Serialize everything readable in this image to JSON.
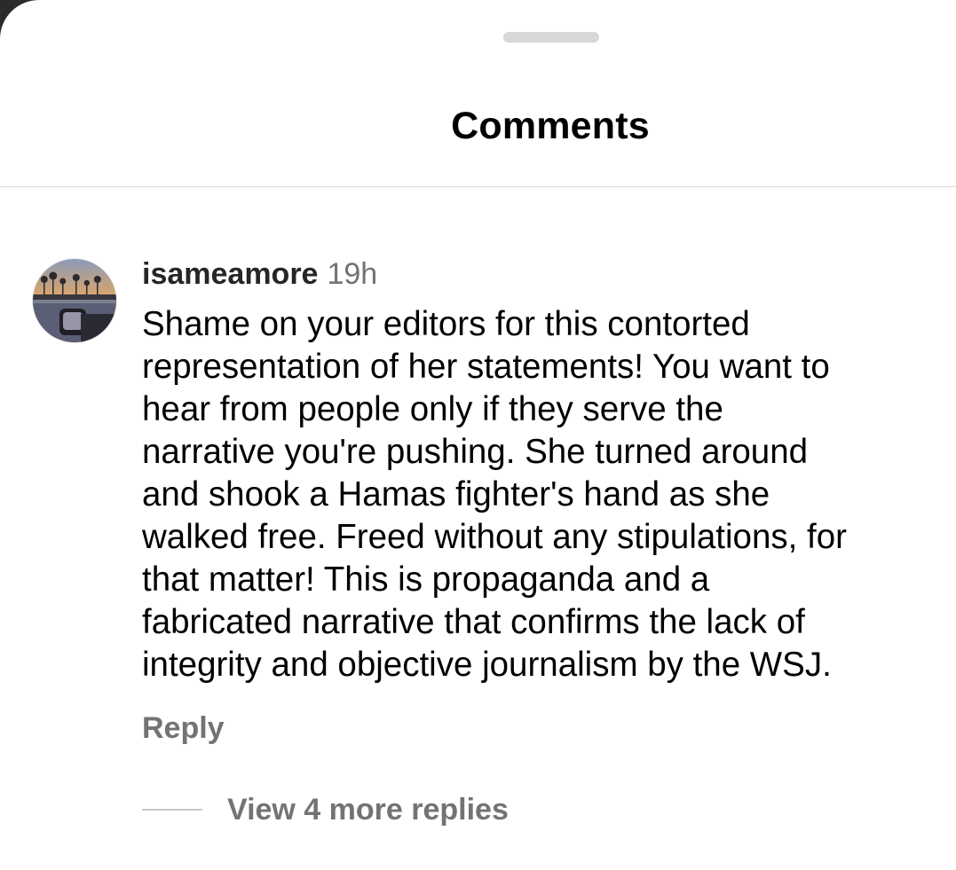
{
  "sheet": {
    "title": "Comments"
  },
  "comment": {
    "username": "isameamore",
    "timestamp": "19h",
    "text": "Shame on your editors for this contorted\nrepresentation of her statements! You want to\nhear from people only if they serve the\nnarrative you're pushing. She turned around\nand shook a Hamas fighter's hand as she\nwalked free. Freed without any stipulations, for\nthat matter! This is propaganda and a\nfabricated narrative that confirms the lack of\nintegrity and objective journalism by the WSJ.",
    "reply_label": "Reply",
    "view_replies_label": "View 4 more replies"
  },
  "colors": {
    "background": "#ffffff",
    "primary_text": "#000000",
    "secondary_text": "#737373",
    "divider": "#dbdbdb"
  },
  "icons": {
    "avatar": "user-avatar-sunset-photo"
  }
}
